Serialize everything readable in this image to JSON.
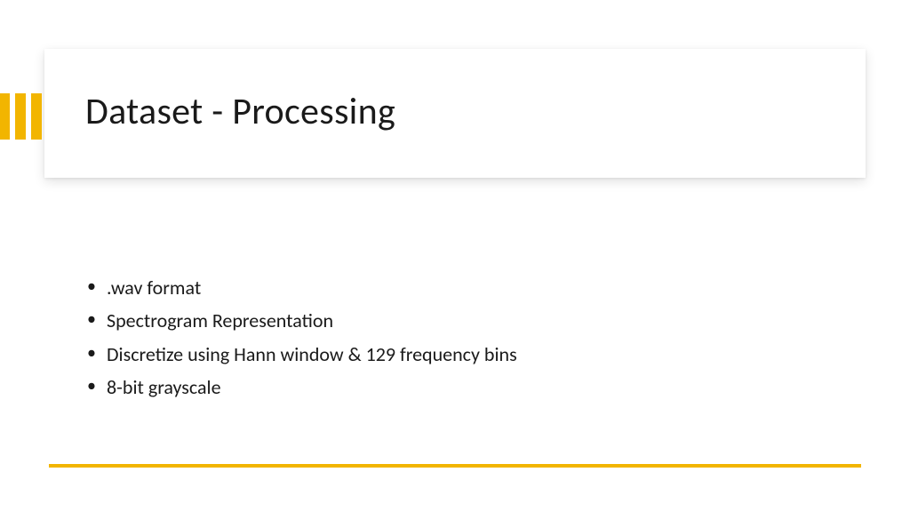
{
  "slide": {
    "title": "Dataset - Processing",
    "bullets": [
      ".wav format",
      "Spectrogram Representation",
      "Discretize using Hann window & 129 frequency bins",
      " 8-bit grayscale"
    ],
    "accent_color": "#f2b500"
  }
}
